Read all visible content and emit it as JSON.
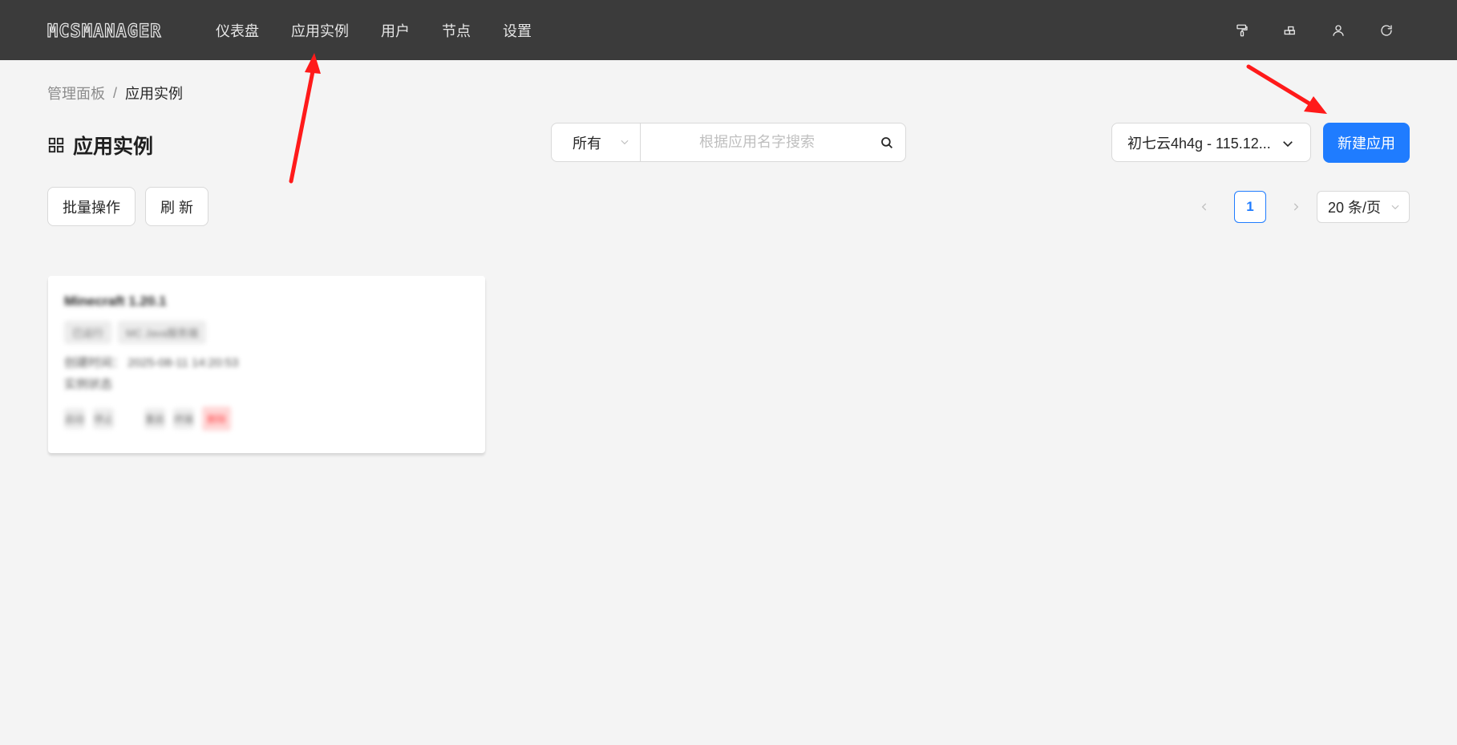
{
  "header": {
    "logo": "MCSMANAGER",
    "nav": [
      "仪表盘",
      "应用实例",
      "用户",
      "节点",
      "设置"
    ],
    "icons": [
      "paint-roller-icon",
      "blocks-icon",
      "user-icon",
      "refresh-icon"
    ]
  },
  "breadcrumb": {
    "root": "管理面板",
    "separator": "/",
    "current": "应用实例"
  },
  "page": {
    "title": "应用实例"
  },
  "filter": {
    "type_value": "所有",
    "search_placeholder": "根据应用名字搜索",
    "node_value": "初七云4h4g - 115.12...",
    "new_button": "新建应用"
  },
  "toolbar": {
    "batch_label": "批量操作",
    "refresh_label": "刷 新"
  },
  "pagination": {
    "current_page": "1",
    "page_size": "20 条/页"
  },
  "card": {
    "title": "Minecraft 1.20.1",
    "tags": [
      "已运行",
      "MC Java服务端"
    ],
    "created": "创建时间： 2025-08-11 14:20:53",
    "extra": "实例状态",
    "actions": [
      "启动",
      "停止",
      "重启",
      "终端",
      "删除"
    ]
  },
  "colors": {
    "topbar": "#3b3b3b",
    "background": "#f4f4f4",
    "primary": "#1f7cff",
    "annotation_arrow": "#ff1a1a"
  }
}
